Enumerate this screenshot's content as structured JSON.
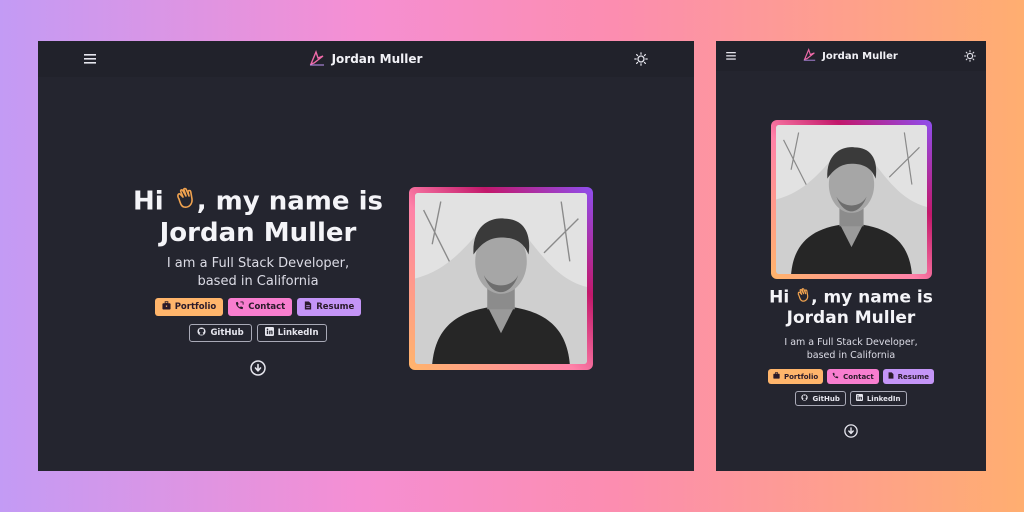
{
  "site": {
    "brand_name": "Jordan Muller",
    "nav_icons": [
      "menu-icon",
      "sun-icon",
      "logo-icon"
    ]
  },
  "hero": {
    "greeting_prefix": "Hi",
    "greeting_suffix": ", my name is",
    "name": "Jordan Muller",
    "tagline_line1": "I am a Full Stack Developer,",
    "tagline_line2": "based in California",
    "wave_icon": "waving-hand-icon",
    "buttons": [
      {
        "label": "Portfolio",
        "icon": "briefcase-icon",
        "color": "#ffb56b"
      },
      {
        "label": "Contact",
        "icon": "phone-icon",
        "color": "#f87ecf"
      },
      {
        "label": "Resume",
        "icon": "document-icon",
        "color": "#c495f7"
      }
    ],
    "social": [
      {
        "label": "GitHub",
        "icon": "github-icon"
      },
      {
        "label": "LinkedIn",
        "icon": "linkedin-icon"
      }
    ],
    "scroll_icon": "arrow-down-circle-icon"
  },
  "colors": {
    "background": "#24252f",
    "nav": "#21222b",
    "accent_orange": "#ffb56b",
    "accent_pink": "#f87ecf",
    "accent_purple": "#c495f7"
  }
}
